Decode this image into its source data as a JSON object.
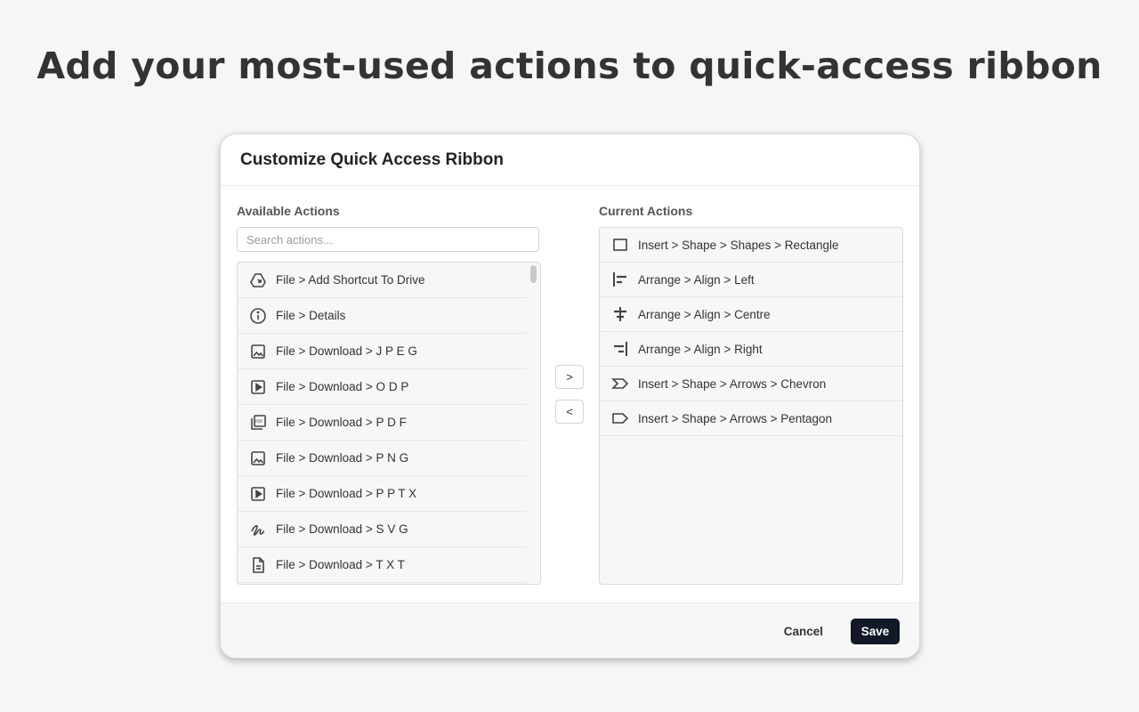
{
  "headline": "Add your most-used actions to quick-access ribbon",
  "dialog": {
    "title": "Customize Quick Access Ribbon",
    "available_label": "Available Actions",
    "current_label": "Current Actions",
    "search_placeholder": "Search actions...",
    "move_right_label": ">",
    "move_left_label": "<",
    "cancel_label": "Cancel",
    "save_label": "Save",
    "available_actions": [
      {
        "icon": "drive-shortcut-icon",
        "label": "File > Add Shortcut To Drive"
      },
      {
        "icon": "info-icon",
        "label": "File > Details"
      },
      {
        "icon": "image-icon",
        "label": "File > Download > J P E G"
      },
      {
        "icon": "slides-play-icon",
        "label": "File > Download > O D P"
      },
      {
        "icon": "pdf-icon",
        "label": "File > Download > P D F"
      },
      {
        "icon": "image-icon",
        "label": "File > Download > P N G"
      },
      {
        "icon": "slides-play-icon",
        "label": "File > Download > P P T X"
      },
      {
        "icon": "svg-squiggle-icon",
        "label": "File > Download > S V G"
      },
      {
        "icon": "text-file-icon",
        "label": "File > Download > T X T"
      }
    ],
    "current_actions": [
      {
        "icon": "rectangle-icon",
        "label": "Insert > Shape > Shapes > Rectangle"
      },
      {
        "icon": "align-left-icon",
        "label": "Arrange > Align > Left"
      },
      {
        "icon": "align-centre-icon",
        "label": "Arrange > Align > Centre"
      },
      {
        "icon": "align-right-icon",
        "label": "Arrange > Align > Right"
      },
      {
        "icon": "chevron-shape-icon",
        "label": "Insert > Shape > Arrows > Chevron"
      },
      {
        "icon": "pentagon-shape-icon",
        "label": "Insert > Shape > Arrows > Pentagon"
      }
    ]
  }
}
